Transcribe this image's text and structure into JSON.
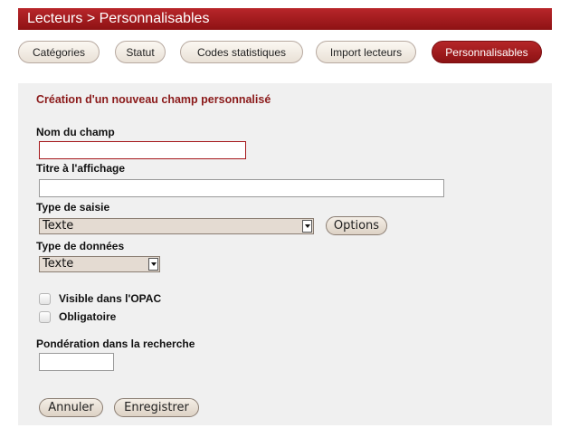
{
  "header": {
    "title": "Lecteurs > Personnalisables"
  },
  "tabs": [
    {
      "label": "Catégories",
      "active": false
    },
    {
      "label": "Statut",
      "active": false
    },
    {
      "label": "Codes statistiques",
      "active": false
    },
    {
      "label": "Import lecteurs",
      "active": false
    },
    {
      "label": "Personnalisables",
      "active": true
    }
  ],
  "form": {
    "heading": "Création d'un nouveau champ personnalisé",
    "nom_du_champ": {
      "label": "Nom du champ",
      "value": ""
    },
    "titre_affichage": {
      "label": "Titre à l'affichage",
      "value": ""
    },
    "type_saisie": {
      "label": "Type de saisie",
      "selected": "Texte",
      "options_button": "Options"
    },
    "type_donnees": {
      "label": "Type de données",
      "selected": "Texte"
    },
    "visible_opac": {
      "label": "Visible dans l'OPAC",
      "checked": false
    },
    "obligatoire": {
      "label": "Obligatoire",
      "checked": false
    },
    "ponderation": {
      "label": "Pondération dans la recherche",
      "value": ""
    },
    "cancel_label": "Annuler",
    "save_label": "Enregistrer"
  },
  "colors": {
    "accent": "#a5161a",
    "heading": "#8b1a1a",
    "panel_bg": "#f0f0f0"
  }
}
